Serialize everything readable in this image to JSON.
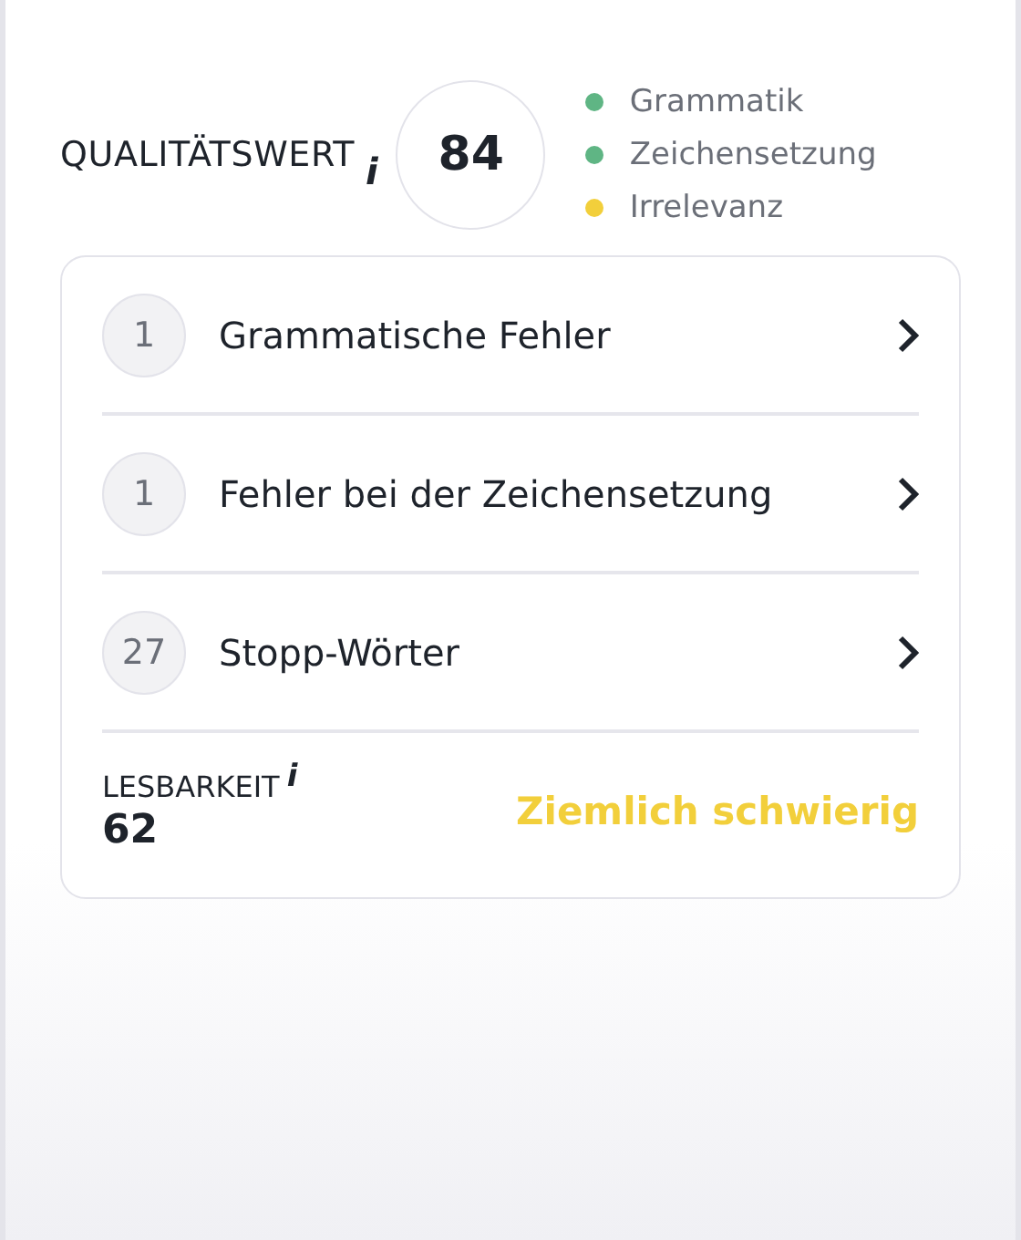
{
  "quality": {
    "title": "QUALITÄTSWERT",
    "info": "i",
    "score": "84",
    "legend": [
      {
        "label": "Grammatik",
        "color": "#5fb584"
      },
      {
        "label": "Zeichensetzung",
        "color": "#5fb584"
      },
      {
        "label": "Irrelevanz",
        "color": "#f2cf3b"
      }
    ]
  },
  "issues": [
    {
      "count": "1",
      "label": "Grammatische Fehler"
    },
    {
      "count": "1",
      "label": "Fehler bei der Zeichensetzung"
    },
    {
      "count": "27",
      "label": "Stopp-Wörter"
    }
  ],
  "readability": {
    "title": "LESBARKEIT",
    "info": "i",
    "score": "62",
    "rating": "Ziemlich schwierig"
  }
}
